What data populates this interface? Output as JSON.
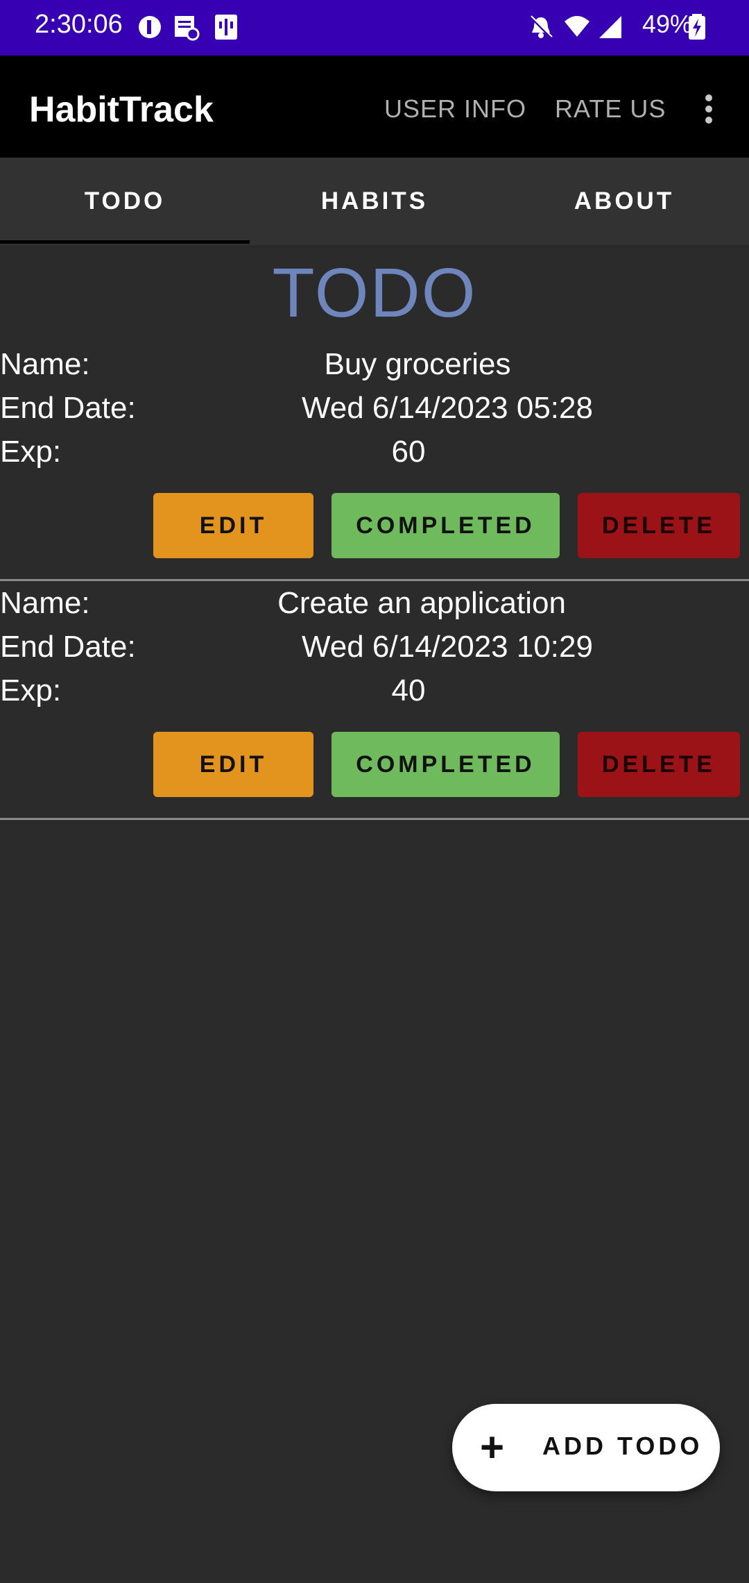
{
  "status_bar": {
    "time": "2:30:06",
    "battery": "49%",
    "icons": [
      "circle-status-icon",
      "document-check-icon",
      "usb-icon",
      "bell-off-icon",
      "wifi-icon",
      "signal-icon",
      "battery-charging-icon"
    ]
  },
  "app_bar": {
    "title": "HabitTrack",
    "actions": [
      "USER INFO",
      "RATE US"
    ],
    "overflow_icon": "more-vertical-icon"
  },
  "tabs": [
    {
      "label": "TODO",
      "selected": true
    },
    {
      "label": "HABITS",
      "selected": false
    },
    {
      "label": "ABOUT",
      "selected": false
    }
  ],
  "section_title": "TODO",
  "todos": [
    {
      "name_label": "Name:",
      "name": "Buy groceries",
      "end_label": "End Date:",
      "end_date": "Wed 6/14/2023 05:28",
      "exp_label": "Exp:",
      "exp": "60",
      "buttons": {
        "edit": "EDIT",
        "completed": "COMPLETED",
        "delete": "DELETE"
      }
    },
    {
      "name_label": "Name:",
      "name": "Create an application",
      "end_label": "End Date:",
      "end_date": "Wed 6/14/2023 10:29",
      "exp_label": "Exp:",
      "exp": "40",
      "buttons": {
        "edit": "EDIT",
        "completed": "COMPLETED",
        "delete": "DELETE"
      }
    }
  ],
  "fab": {
    "icon": "plus-icon",
    "label": "ADD TODO"
  },
  "colors": {
    "status_bar": "#3700b3",
    "title_accent": "#6f86bd",
    "edit": "#e3941e",
    "completed": "#6fba5d",
    "delete": "#9b1317"
  }
}
